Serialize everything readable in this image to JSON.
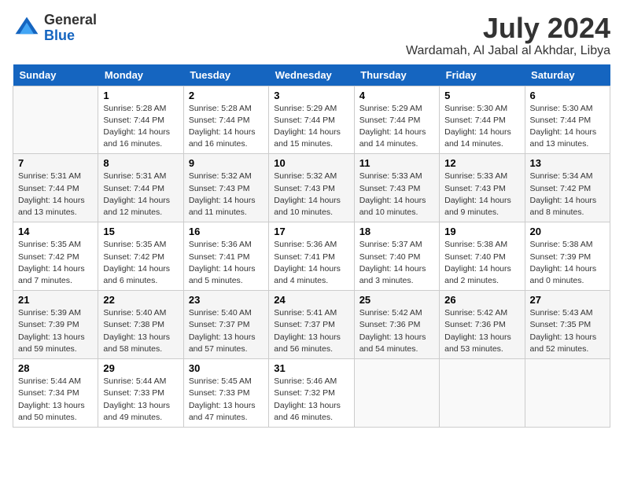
{
  "header": {
    "logo_general": "General",
    "logo_blue": "Blue",
    "month_title": "July 2024",
    "location": "Wardamah, Al Jabal al Akhdar, Libya"
  },
  "weekdays": [
    "Sunday",
    "Monday",
    "Tuesday",
    "Wednesday",
    "Thursday",
    "Friday",
    "Saturday"
  ],
  "weeks": [
    [
      {
        "day": "",
        "info": ""
      },
      {
        "day": "1",
        "info": "Sunrise: 5:28 AM\nSunset: 7:44 PM\nDaylight: 14 hours\nand 16 minutes."
      },
      {
        "day": "2",
        "info": "Sunrise: 5:28 AM\nSunset: 7:44 PM\nDaylight: 14 hours\nand 16 minutes."
      },
      {
        "day": "3",
        "info": "Sunrise: 5:29 AM\nSunset: 7:44 PM\nDaylight: 14 hours\nand 15 minutes."
      },
      {
        "day": "4",
        "info": "Sunrise: 5:29 AM\nSunset: 7:44 PM\nDaylight: 14 hours\nand 14 minutes."
      },
      {
        "day": "5",
        "info": "Sunrise: 5:30 AM\nSunset: 7:44 PM\nDaylight: 14 hours\nand 14 minutes."
      },
      {
        "day": "6",
        "info": "Sunrise: 5:30 AM\nSunset: 7:44 PM\nDaylight: 14 hours\nand 13 minutes."
      }
    ],
    [
      {
        "day": "7",
        "info": "Sunrise: 5:31 AM\nSunset: 7:44 PM\nDaylight: 14 hours\nand 13 minutes."
      },
      {
        "day": "8",
        "info": "Sunrise: 5:31 AM\nSunset: 7:44 PM\nDaylight: 14 hours\nand 12 minutes."
      },
      {
        "day": "9",
        "info": "Sunrise: 5:32 AM\nSunset: 7:43 PM\nDaylight: 14 hours\nand 11 minutes."
      },
      {
        "day": "10",
        "info": "Sunrise: 5:32 AM\nSunset: 7:43 PM\nDaylight: 14 hours\nand 10 minutes."
      },
      {
        "day": "11",
        "info": "Sunrise: 5:33 AM\nSunset: 7:43 PM\nDaylight: 14 hours\nand 10 minutes."
      },
      {
        "day": "12",
        "info": "Sunrise: 5:33 AM\nSunset: 7:43 PM\nDaylight: 14 hours\nand 9 minutes."
      },
      {
        "day": "13",
        "info": "Sunrise: 5:34 AM\nSunset: 7:42 PM\nDaylight: 14 hours\nand 8 minutes."
      }
    ],
    [
      {
        "day": "14",
        "info": "Sunrise: 5:35 AM\nSunset: 7:42 PM\nDaylight: 14 hours\nand 7 minutes."
      },
      {
        "day": "15",
        "info": "Sunrise: 5:35 AM\nSunset: 7:42 PM\nDaylight: 14 hours\nand 6 minutes."
      },
      {
        "day": "16",
        "info": "Sunrise: 5:36 AM\nSunset: 7:41 PM\nDaylight: 14 hours\nand 5 minutes."
      },
      {
        "day": "17",
        "info": "Sunrise: 5:36 AM\nSunset: 7:41 PM\nDaylight: 14 hours\nand 4 minutes."
      },
      {
        "day": "18",
        "info": "Sunrise: 5:37 AM\nSunset: 7:40 PM\nDaylight: 14 hours\nand 3 minutes."
      },
      {
        "day": "19",
        "info": "Sunrise: 5:38 AM\nSunset: 7:40 PM\nDaylight: 14 hours\nand 2 minutes."
      },
      {
        "day": "20",
        "info": "Sunrise: 5:38 AM\nSunset: 7:39 PM\nDaylight: 14 hours\nand 0 minutes."
      }
    ],
    [
      {
        "day": "21",
        "info": "Sunrise: 5:39 AM\nSunset: 7:39 PM\nDaylight: 13 hours\nand 59 minutes."
      },
      {
        "day": "22",
        "info": "Sunrise: 5:40 AM\nSunset: 7:38 PM\nDaylight: 13 hours\nand 58 minutes."
      },
      {
        "day": "23",
        "info": "Sunrise: 5:40 AM\nSunset: 7:37 PM\nDaylight: 13 hours\nand 57 minutes."
      },
      {
        "day": "24",
        "info": "Sunrise: 5:41 AM\nSunset: 7:37 PM\nDaylight: 13 hours\nand 56 minutes."
      },
      {
        "day": "25",
        "info": "Sunrise: 5:42 AM\nSunset: 7:36 PM\nDaylight: 13 hours\nand 54 minutes."
      },
      {
        "day": "26",
        "info": "Sunrise: 5:42 AM\nSunset: 7:36 PM\nDaylight: 13 hours\nand 53 minutes."
      },
      {
        "day": "27",
        "info": "Sunrise: 5:43 AM\nSunset: 7:35 PM\nDaylight: 13 hours\nand 52 minutes."
      }
    ],
    [
      {
        "day": "28",
        "info": "Sunrise: 5:44 AM\nSunset: 7:34 PM\nDaylight: 13 hours\nand 50 minutes."
      },
      {
        "day": "29",
        "info": "Sunrise: 5:44 AM\nSunset: 7:33 PM\nDaylight: 13 hours\nand 49 minutes."
      },
      {
        "day": "30",
        "info": "Sunrise: 5:45 AM\nSunset: 7:33 PM\nDaylight: 13 hours\nand 47 minutes."
      },
      {
        "day": "31",
        "info": "Sunrise: 5:46 AM\nSunset: 7:32 PM\nDaylight: 13 hours\nand 46 minutes."
      },
      {
        "day": "",
        "info": ""
      },
      {
        "day": "",
        "info": ""
      },
      {
        "day": "",
        "info": ""
      }
    ]
  ]
}
